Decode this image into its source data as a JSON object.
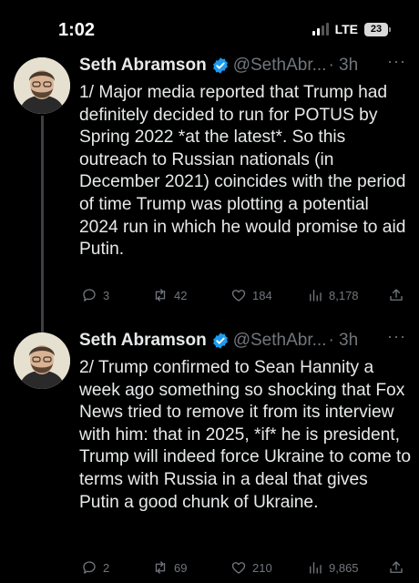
{
  "status_bar": {
    "time": "1:02",
    "network": "LTE",
    "battery": "23"
  },
  "tweets": [
    {
      "name": "Seth Abramson",
      "handle": "@SethAbr...",
      "dot_time": "· 3h",
      "more": "···",
      "text": "1/ Major media reported that Trump had definitely decided to run for POTUS by Spring 2022 *at the latest*. So this outreach to Russian nationals (in December 2021) coincides with the period of time Trump was plotting a potential 2024 run in which he would promise to aid Putin.",
      "replies": "3",
      "retweets": "42",
      "likes": "184",
      "views": "8,178"
    },
    {
      "name": "Seth Abramson",
      "handle": "@SethAbr...",
      "dot_time": "· 3h",
      "more": "···",
      "text": "2/ Trump confirmed to Sean Hannity a week ago something so shocking that Fox News tried to remove it from its interview with him: that in 2025, *if* he is president, Trump will indeed force Ukraine to come to terms with Russia in a deal that gives Putin a good chunk of Ukraine.",
      "replies": "2",
      "retweets": "69",
      "likes": "210",
      "views": "9,865"
    }
  ],
  "colors": {
    "background": "#000000",
    "text": "#e7e9ea",
    "muted": "#71767b",
    "verified": "#1d9bf0"
  },
  "icons": [
    "reply-icon",
    "retweet-icon",
    "like-icon",
    "views-icon",
    "share-icon",
    "verified-badge-icon"
  ]
}
